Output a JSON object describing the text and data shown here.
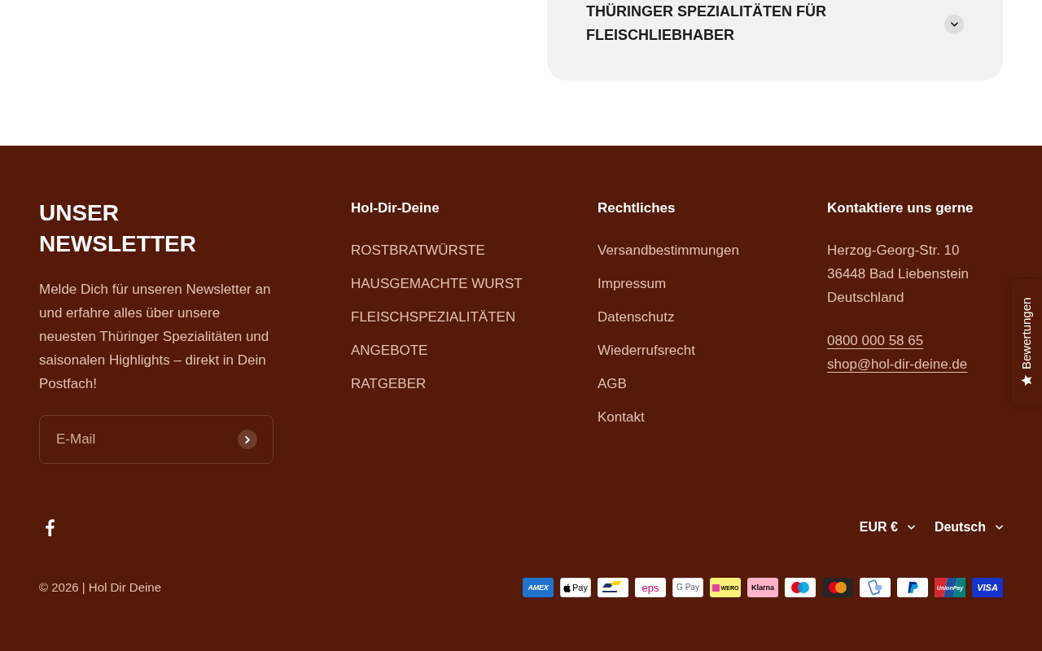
{
  "accordion": {
    "title": "THÜRINGER SPEZIALITÄTEN FÜR FLEISCHLIEBHABER",
    "expanded": false
  },
  "footer": {
    "newsletter": {
      "heading": "UNSER NEWSLETTER",
      "text": "Melde Dich für unseren Newsletter an und erfahre alles über unsere neuesten Thüringer Spezialitäten und saisonalen Highlights – direkt in Dein Postfach!",
      "email_field": {
        "placeholder": "E-Mail"
      }
    },
    "columns": [
      {
        "heading": "Hol-Dir-Deine",
        "links": [
          "ROSTBRATWÜRSTE",
          "HAUSGEMACHTE WURST",
          "FLEISCHSPEZIALITÄTEN",
          "ANGEBOTE",
          "RATGEBER"
        ]
      },
      {
        "heading": "Rechtliches",
        "links": [
          "Versandbestimmungen",
          "Impressum",
          "Datenschutz",
          "Wiederrufsrecht",
          "AGB",
          "Kontakt"
        ]
      }
    ],
    "contact": {
      "heading": "Kontaktiere uns gerne",
      "address_lines": [
        "Herzog-Georg-Str. 10",
        "36448 Bad Liebenstein",
        "Deutschland"
      ],
      "links": [
        "0800 000 58 65",
        "shop@hol-dir-deine.de"
      ]
    },
    "social_links": [
      {
        "kind": "facebook"
      }
    ],
    "currency_selector": {
      "value": "EUR €"
    },
    "language_selector": {
      "value": "Deutsch"
    },
    "copyright": "© 2026 | Hol Dir Deine",
    "payment_methods": [
      {
        "kind": "amex",
        "label": "AMEX"
      },
      {
        "kind": "applepay",
        "label": "Pay"
      },
      {
        "kind": "bancontact"
      },
      {
        "kind": "eps",
        "label": "eps"
      },
      {
        "kind": "googlepay",
        "label": "G Pay"
      },
      {
        "kind": "wero",
        "label": "WERO"
      },
      {
        "kind": "klarna",
        "label": "Klarna"
      },
      {
        "kind": "maestro"
      },
      {
        "kind": "mastercard"
      },
      {
        "kind": "contactless"
      },
      {
        "kind": "paypal"
      },
      {
        "kind": "unionpay",
        "label": "UnionPay"
      },
      {
        "kind": "visa",
        "label": "VISA"
      }
    ]
  },
  "reviews_tab": {
    "label": "Bewertungen"
  }
}
